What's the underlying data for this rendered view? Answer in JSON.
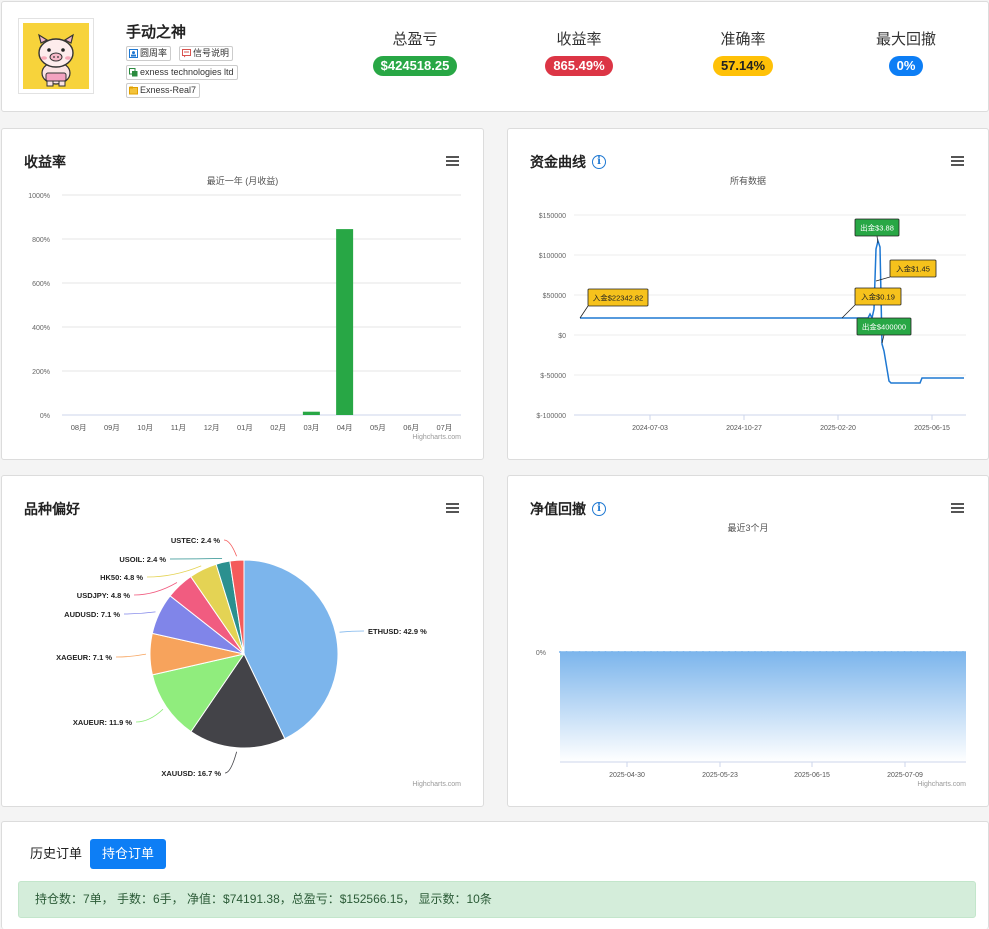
{
  "header": {
    "trader_name": "手动之神",
    "tags": [
      {
        "label": "圆周率",
        "icon": "user-card-icon",
        "color": "#1e78d2"
      },
      {
        "label": "信号说明",
        "icon": "message-icon",
        "color": "#d9534f"
      },
      {
        "label": "exness technologies ltd",
        "icon": "copy-icon",
        "color": "#2a8a3e"
      },
      {
        "label": "Exness-Real7",
        "icon": "folder-icon",
        "color": "#e0a000"
      }
    ],
    "stats": [
      {
        "label": "总盈亏",
        "value": "$424518.25",
        "color": "#28a745"
      },
      {
        "label": "收益率",
        "value": "865.49%",
        "color": "#dc3545"
      },
      {
        "label": "准确率",
        "value": "57.14%",
        "color": "#ffc107"
      },
      {
        "label": "最大回撤",
        "value": "0%",
        "color": "#0d7ef5"
      }
    ]
  },
  "returns_panel": {
    "title": "收益率",
    "credits": "Highcharts.com",
    "chart_data": {
      "type": "bar",
      "subtitle": "最近一年 (月收益)",
      "categories": [
        "08月",
        "09月",
        "10月",
        "11月",
        "12月",
        "01月",
        "02月",
        "03月",
        "04月",
        "05月",
        "06月",
        "07月"
      ],
      "values": [
        0,
        0,
        0,
        0,
        0,
        0,
        0,
        15,
        845,
        0,
        0,
        0
      ],
      "ylim": [
        0,
        1000
      ],
      "yticks": [
        "0%",
        "200%",
        "400%",
        "600%",
        "800%",
        "1000%"
      ],
      "ytick_values": [
        0,
        200,
        400,
        600,
        800,
        1000
      ],
      "color": "#28a745"
    }
  },
  "equity_panel": {
    "title": "资金曲线",
    "credits": "",
    "chart_data": {
      "type": "line",
      "subtitle": "所有数据",
      "xticks": [
        "2024-07-03",
        "2024-10-27",
        "2025-02-20",
        "2025-06-15"
      ],
      "yticks": [
        "$150000",
        "$100000",
        "$50000",
        "$0",
        "$-50000",
        "$-100000"
      ],
      "ytick_values": [
        150000,
        100000,
        50000,
        0,
        -50000,
        -100000
      ],
      "ylim": [
        -100000,
        150000
      ],
      "color": "#1e78d2",
      "annotations": [
        {
          "label": "入金$22342.82",
          "type": "deposit"
        },
        {
          "label": "出金$3.88",
          "type": "withdraw"
        },
        {
          "label": "入金$1.45",
          "type": "deposit"
        },
        {
          "label": "入金$0.19",
          "type": "deposit"
        },
        {
          "label": "出金$400000",
          "type": "withdraw"
        }
      ]
    }
  },
  "symbol_panel": {
    "title": "品种偏好",
    "credits": "Highcharts.com",
    "chart_data": {
      "type": "pie",
      "slices": [
        {
          "name": "ETHUSD",
          "value": 42.9,
          "label": "ETHUSD: 42.9 %",
          "color": "#7cb5ec"
        },
        {
          "name": "XAUUSD",
          "value": 16.7,
          "label": "XAUUSD: 16.7 %",
          "color": "#434348"
        },
        {
          "name": "XAUEUR",
          "value": 11.9,
          "label": "XAUEUR: 11.9 %",
          "color": "#90ed7d"
        },
        {
          "name": "XAGEUR",
          "value": 7.1,
          "label": "XAGEUR: 7.1 %",
          "color": "#f7a35c"
        },
        {
          "name": "AUDUSD",
          "value": 7.1,
          "label": "AUDUSD: 7.1 %",
          "color": "#8085e9"
        },
        {
          "name": "USDJPY",
          "value": 4.8,
          "label": "USDJPY: 4.8 %",
          "color": "#f15c80"
        },
        {
          "name": "HK50",
          "value": 4.8,
          "label": "HK50: 4.8 %",
          "color": "#e4d354"
        },
        {
          "name": "USOIL",
          "value": 2.4,
          "label": "USOIL: 2.4 %",
          "color": "#2b908f"
        },
        {
          "name": "USTEC",
          "value": 2.4,
          "label": "USTEC: 2.4 %",
          "color": "#f45b5b"
        }
      ]
    }
  },
  "drawdown_panel": {
    "title": "净值回撤",
    "credits": "Highcharts.com",
    "chart_data": {
      "type": "area",
      "subtitle": "最近3个月",
      "xticks": [
        "2025-04-30",
        "2025-05-23",
        "2025-06-15",
        "2025-07-09"
      ],
      "yticks": [
        "0%"
      ],
      "values_label": "0%",
      "color": "#7cb5ec"
    }
  },
  "orders": {
    "tabs": [
      "历史订单",
      "持仓订单"
    ],
    "active_tab": "持仓订单",
    "summary": "持仓数：7单， 手数：6手， 净值：$74191.38，总盈亏：$152566.15， 显示数：10条"
  }
}
